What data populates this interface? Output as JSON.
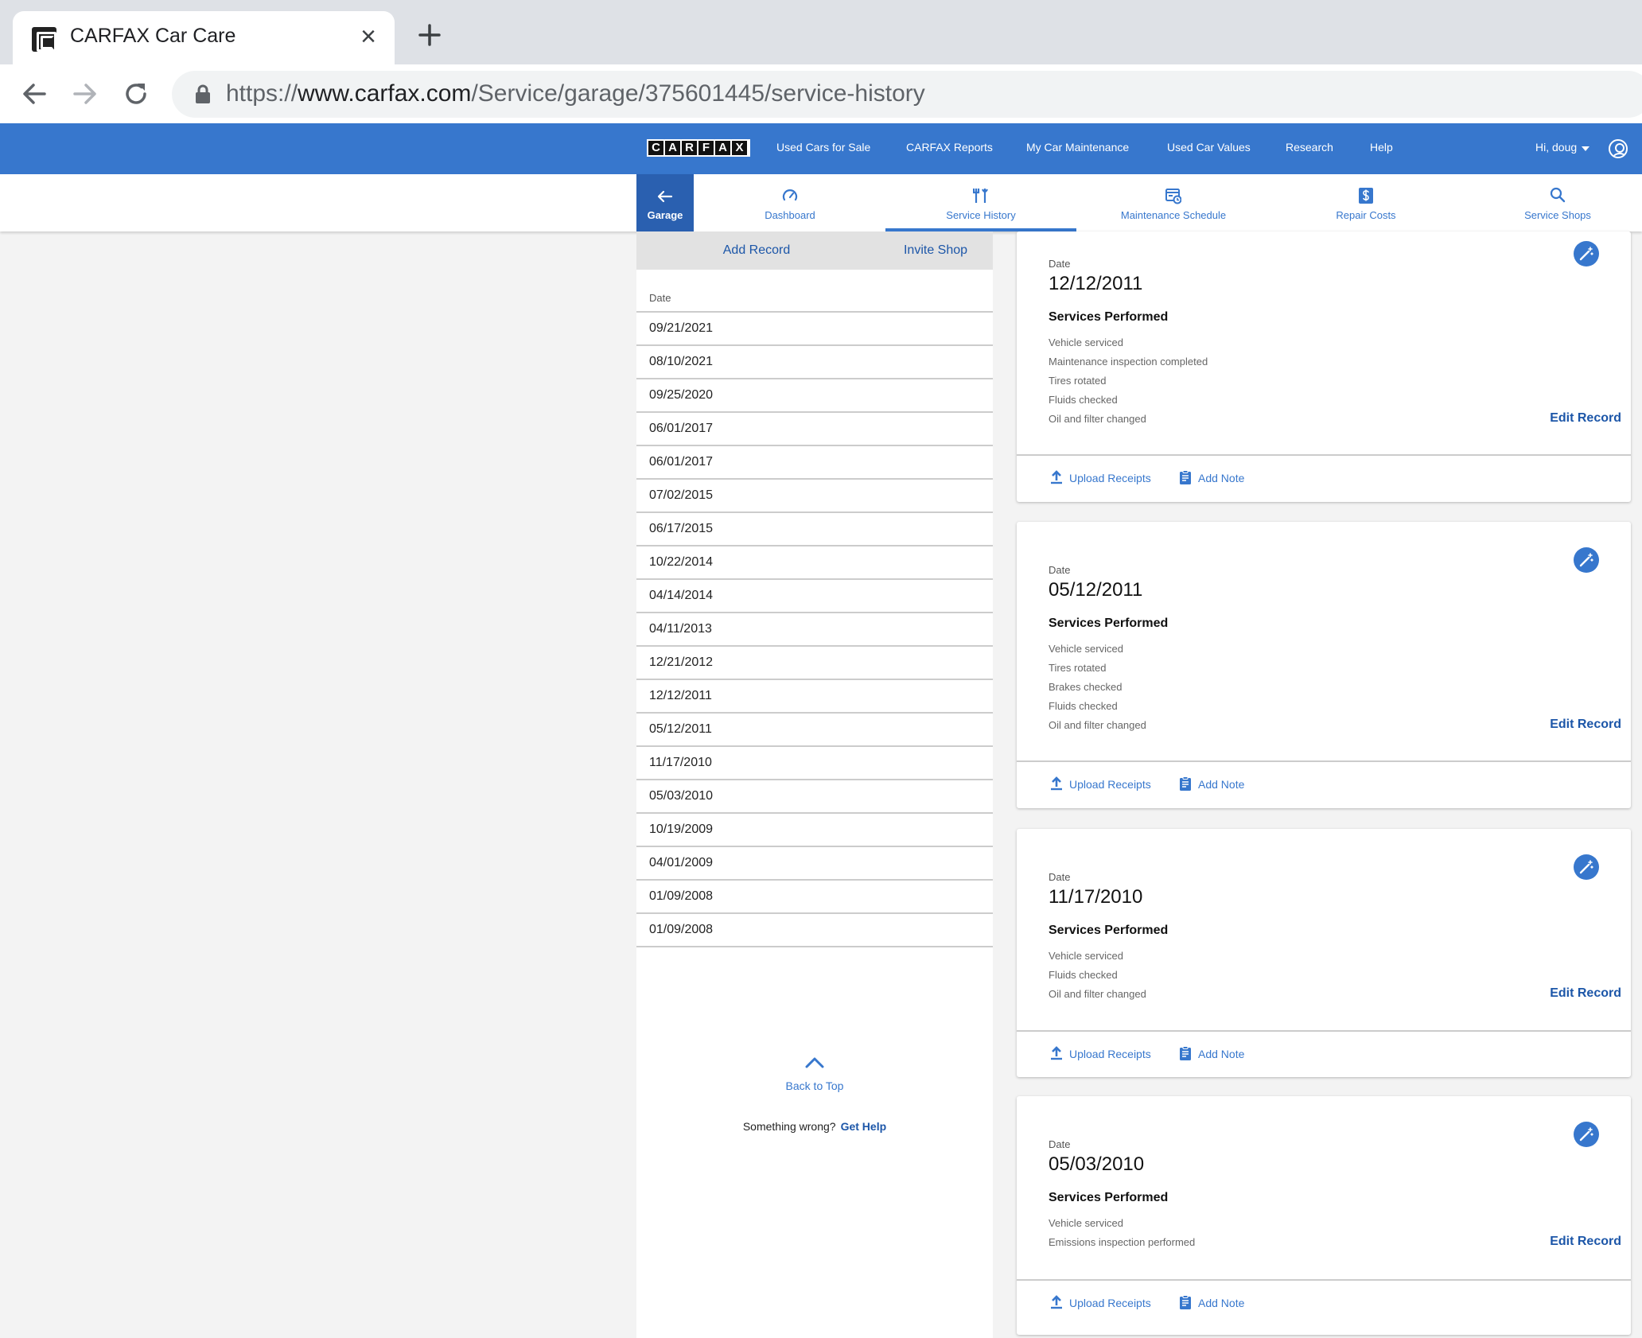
{
  "browser": {
    "tab_title": "CARFAX Car Care",
    "url_scheme": "https://",
    "url_host": "www.carfax.com",
    "url_path": "/Service/garage/375601445/service-history"
  },
  "site_nav": {
    "logo_letters": [
      "C",
      "A",
      "R",
      "F",
      "A",
      "X"
    ],
    "links": [
      "Used Cars for Sale",
      "CARFAX Reports",
      "My Car Maintenance",
      "Used Car Values",
      "Research",
      "Help"
    ],
    "greeting": "Hi, doug"
  },
  "sub_nav": {
    "garage": "Garage",
    "tabs": [
      {
        "label": "Dashboard",
        "icon": "gauge-icon"
      },
      {
        "label": "Service History",
        "icon": "tools-icon"
      },
      {
        "label": "Maintenance Schedule",
        "icon": "schedule-icon"
      },
      {
        "label": "Repair Costs",
        "icon": "dollar-icon"
      },
      {
        "label": "Service Shops",
        "icon": "search-icon"
      }
    ],
    "active": "Service History"
  },
  "left": {
    "add_record": "Add Record",
    "invite_shop": "Invite Shop",
    "date_header": "Date",
    "dates": [
      "09/21/2021",
      "08/10/2021",
      "09/25/2020",
      "06/01/2017",
      "06/01/2017",
      "07/02/2015",
      "06/17/2015",
      "10/22/2014",
      "04/14/2014",
      "04/11/2013",
      "12/21/2012",
      "12/12/2011",
      "05/12/2011",
      "11/17/2010",
      "05/03/2010",
      "10/19/2009",
      "04/01/2009",
      "01/09/2008",
      "01/09/2008"
    ],
    "back_to_top": "Back to Top",
    "something_wrong": "Something wrong?",
    "get_help": "Get Help"
  },
  "card_labels": {
    "date": "Date",
    "services_performed": "Services Performed",
    "edit_record": "Edit Record",
    "upload_receipts": "Upload Receipts",
    "add_note": "Add Note"
  },
  "records": [
    {
      "date": "12/12/2011",
      "services": [
        "Vehicle serviced",
        "Maintenance inspection completed",
        "Tires rotated",
        "Fluids checked",
        "Oil and filter changed"
      ]
    },
    {
      "date": "05/12/2011",
      "services": [
        "Vehicle serviced",
        "Tires rotated",
        "Brakes checked",
        "Fluids checked",
        "Oil and filter changed"
      ]
    },
    {
      "date": "11/17/2010",
      "services": [
        "Vehicle serviced",
        "Fluids checked",
        "Oil and filter changed"
      ]
    },
    {
      "date": "05/03/2010",
      "services": [
        "Vehicle serviced",
        "Emissions inspection performed"
      ]
    }
  ],
  "colors": {
    "brand_blue": "#3777cd",
    "dark_blue": "#2a60b0",
    "link_blue": "#1c56a8"
  }
}
